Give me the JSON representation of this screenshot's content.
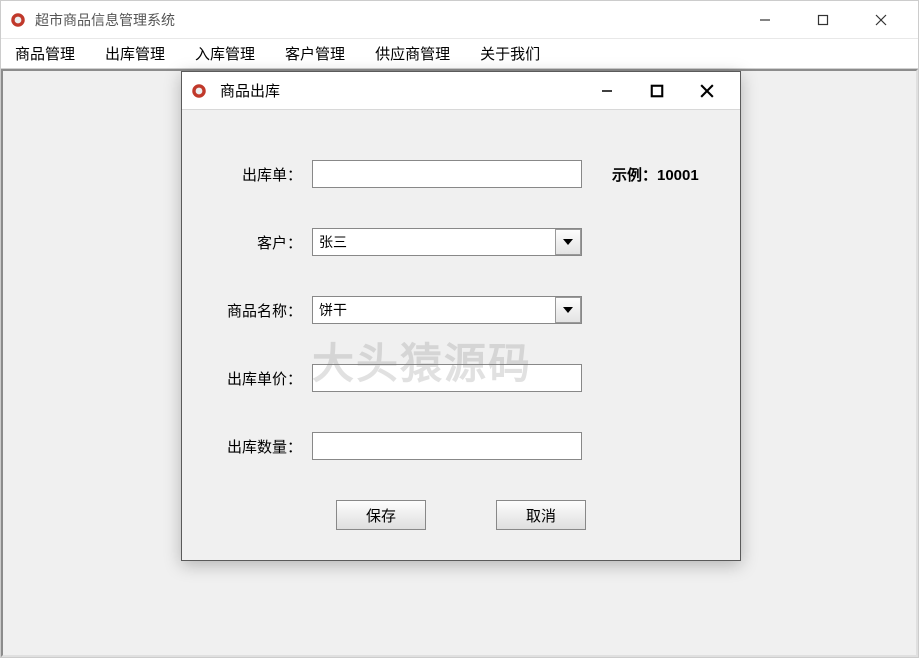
{
  "main_window": {
    "title": "超市商品信息管理系统"
  },
  "menubar": {
    "items": [
      "商品管理",
      "出库管理",
      "入库管理",
      "客户管理",
      "供应商管理",
      "关于我们"
    ]
  },
  "dialog": {
    "title": "商品出库",
    "fields": {
      "order_label": "出库单：",
      "order_value": "",
      "order_hint": "示例：10001",
      "customer_label": "客户：",
      "customer_value": "张三",
      "product_label": "商品名称：",
      "product_value": "饼干",
      "price_label": "出库单价：",
      "price_value": "",
      "quantity_label": "出库数量：",
      "quantity_value": ""
    },
    "buttons": {
      "save": "保存",
      "cancel": "取消"
    }
  },
  "watermark": "大头猿源码"
}
